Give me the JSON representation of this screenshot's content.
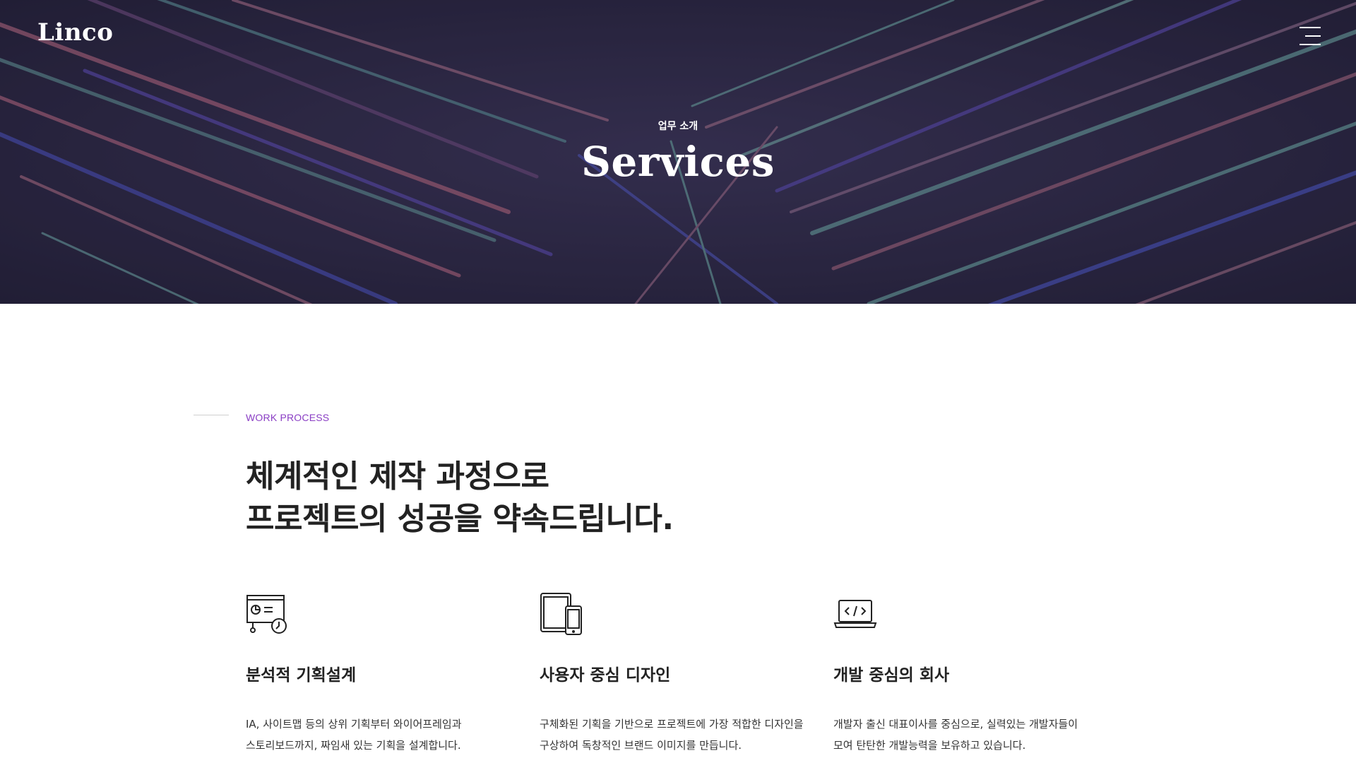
{
  "header": {
    "logo": "Linco",
    "menu_icon": "hamburger-menu-icon"
  },
  "hero": {
    "subtitle": "업무 소개",
    "title": "Services",
    "background": "palm-leaf-photo"
  },
  "section": {
    "eyebrow": "WORK PROCESS",
    "headline": [
      "체계적인 제작 과정으로",
      "프로젝트의 성공을 약속드립니다."
    ],
    "features": [
      {
        "icon": "presentation-chart-icon",
        "title": "분석적 기획설계",
        "desc": [
          "IA, 사이트맵 등의 상위 기획부터 와이어프레임과",
          "스토리보드까지, 짜임새 있는 기획을 설계합니다."
        ]
      },
      {
        "icon": "devices-icon",
        "title": "사용자 중심 디자인",
        "desc": [
          "구체화된 기획을 기반으로 프로젝트에 가장 적합한 디자인을",
          "구상하여 독창적인 브랜드 이미지를 만듭니다."
        ]
      },
      {
        "icon": "laptop-code-icon",
        "title": "개발 중심의 회사",
        "desc": [
          "개발자 출신 대표이사를 중심으로, 실력있는 개발자들이",
          "모여 탄탄한 개발능력을 보유하고 있습니다."
        ]
      }
    ]
  },
  "colors": {
    "hero_bg": "#2a2640",
    "accent": "#8a3ec4",
    "text": "#222222"
  }
}
